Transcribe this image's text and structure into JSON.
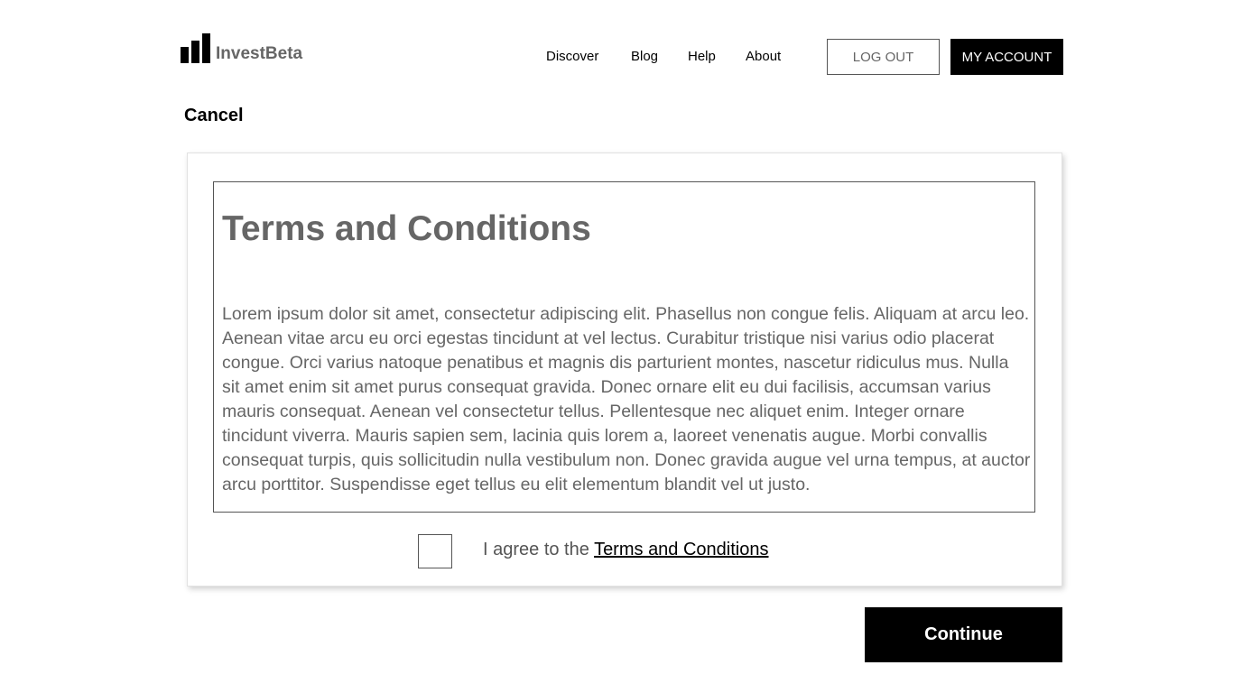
{
  "header": {
    "logo_text": "InvestBeta",
    "nav": [
      {
        "label": "Discover"
      },
      {
        "label": "Blog"
      },
      {
        "label": "Help"
      },
      {
        "label": "About"
      }
    ],
    "logout_label": "LOG OUT",
    "account_label": "MY ACCOUNT"
  },
  "cancel_label": "Cancel",
  "terms": {
    "title": "Terms and Conditions",
    "body": "Lorem ipsum dolor sit amet, consectetur adipiscing elit. Phasellus non congue felis. Aliquam at arcu leo. Aenean vitae arcu eu orci egestas tincidunt at vel lectus. Curabitur tristique nisi varius odio placerat congue. Orci varius natoque penatibus et magnis dis parturient montes, nascetur ridiculus mus. Nulla sit amet enim sit amet purus consequat gravida. Donec ornare elit eu dui facilisis, accumsan varius mauris consequat. Aenean vel consectetur tellus. Pellentesque nec aliquet enim. Integer ornare tincidunt viverra. Mauris sapien sem, lacinia quis lorem a, laoreet venenatis augue. Morbi convallis consequat turpis, quis sollicitudin nulla vestibulum non. Donec gravida augue vel urna tempus, at auctor arcu porttitor. Suspendisse eget tellus eu elit elementum blandit vel ut justo."
  },
  "agreement": {
    "prefix": "I agree to the ",
    "link_label": "Terms and Conditions",
    "checked": false
  },
  "continue_label": "Continue"
}
